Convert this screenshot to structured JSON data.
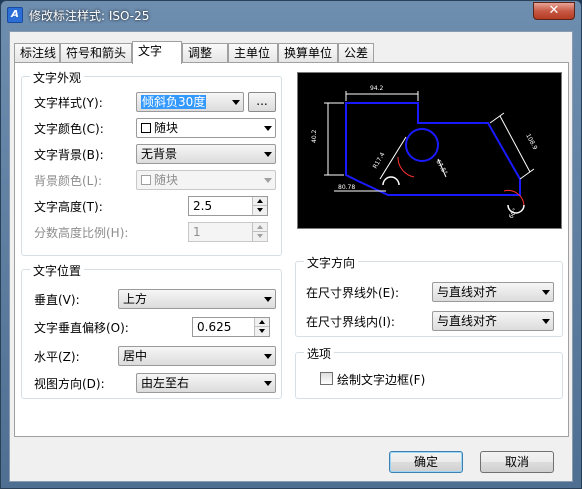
{
  "window": {
    "title": "修改标注样式: ISO-25",
    "close": "✕"
  },
  "tabs": [
    {
      "label": "标注线"
    },
    {
      "label": "符号和箭头"
    },
    {
      "label": "文字"
    },
    {
      "label": "调整"
    },
    {
      "label": "主单位"
    },
    {
      "label": "换算单位"
    },
    {
      "label": "公差"
    }
  ],
  "appearance": {
    "title": "文字外观",
    "style_label": "文字样式(Y):",
    "style_value": "倾斜负30度",
    "style_more": "...",
    "color_label": "文字颜色(C):",
    "color_value": "随块",
    "fill_label": "文字背景(B):",
    "fill_value": "无背景",
    "fillcolor_label": "背景颜色(L):",
    "fillcolor_value": "随块",
    "height_label": "文字高度(T):",
    "height_value": "2.5",
    "fraction_label": "分数高度比例(H):",
    "fraction_value": "1"
  },
  "placement": {
    "title": "文字位置",
    "vertical_label": "垂直(V):",
    "vertical_value": "上方",
    "offset_label": "文字垂直偏移(O):",
    "offset_value": "0.625",
    "horizontal_label": "水平(Z):",
    "horizontal_value": "居中",
    "view_label": "视图方向(D):",
    "view_value": "由左至右"
  },
  "alignment": {
    "title": "文字方向",
    "outside_label": "在尺寸界线外(E):",
    "outside_value": "与直线对齐",
    "inside_label": "在尺寸界线内(I):",
    "inside_value": "与直线对齐"
  },
  "options": {
    "title": "选项",
    "frame_label": "绘制文字边框(F)",
    "frame_checked": false
  },
  "preview": {
    "dim_top": "94.2",
    "dim_left": "40.2",
    "dim_right": "108.9",
    "dim_radius": "R17.4",
    "dim_angle1": "67.5°",
    "dim_angle2": "60°",
    "dim_bottom": "80.78"
  },
  "buttons": {
    "ok": "确定",
    "cancel": "取消"
  },
  "colors": {
    "preview_bg": "#000000",
    "dim_line": "#ffffff",
    "shape_line": "#1a1aff",
    "arc_line": "#ff3030",
    "selection": "#3399ff"
  }
}
